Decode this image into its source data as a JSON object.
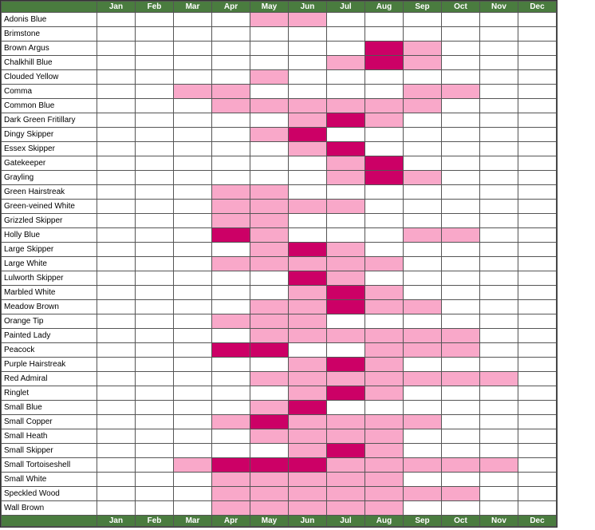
{
  "months": [
    "Jan",
    "Feb",
    "Mar",
    "Apr",
    "May",
    "Jun",
    "Jul",
    "Aug",
    "Sep",
    "Oct",
    "Nov",
    "Dec"
  ],
  "species": [
    {
      "name": "Adonis Blue",
      "cells": [
        "e",
        "e",
        "e",
        "e",
        "pk",
        "pk",
        "e",
        "e",
        "e",
        "e",
        "e",
        "e"
      ]
    },
    {
      "name": "Brimstone",
      "cells": [
        "e",
        "e",
        "e",
        "e",
        "e",
        "e",
        "e",
        "e",
        "e",
        "e",
        "e",
        "e"
      ]
    },
    {
      "name": "Brown Argus",
      "cells": [
        "e",
        "e",
        "e",
        "e",
        "e",
        "e",
        "e",
        "dp",
        "pk",
        "e",
        "e",
        "e"
      ]
    },
    {
      "name": "Chalkhill Blue",
      "cells": [
        "e",
        "e",
        "e",
        "e",
        "e",
        "e",
        "pk",
        "dp",
        "pk",
        "e",
        "e",
        "e"
      ]
    },
    {
      "name": "Clouded Yellow",
      "cells": [
        "e",
        "e",
        "e",
        "e",
        "pk",
        "e",
        "e",
        "e",
        "e",
        "e",
        "e",
        "e"
      ]
    },
    {
      "name": "Comma",
      "cells": [
        "e",
        "e",
        "pk",
        "pk",
        "e",
        "e",
        "e",
        "e",
        "pk",
        "pk",
        "e",
        "e"
      ]
    },
    {
      "name": "Common Blue",
      "cells": [
        "e",
        "e",
        "e",
        "pk",
        "pk",
        "pk",
        "pk",
        "pk",
        "pk",
        "e",
        "e",
        "e"
      ]
    },
    {
      "name": "Dark Green Fritillary",
      "cells": [
        "e",
        "e",
        "e",
        "e",
        "e",
        "pk",
        "dp",
        "pk",
        "e",
        "e",
        "e",
        "e"
      ]
    },
    {
      "name": "Dingy Skipper",
      "cells": [
        "e",
        "e",
        "e",
        "e",
        "pk",
        "dp",
        "e",
        "e",
        "e",
        "e",
        "e",
        "e"
      ]
    },
    {
      "name": "Essex Skipper",
      "cells": [
        "e",
        "e",
        "e",
        "e",
        "e",
        "pk",
        "dp",
        "e",
        "e",
        "e",
        "e",
        "e"
      ]
    },
    {
      "name": "Gatekeeper",
      "cells": [
        "e",
        "e",
        "e",
        "e",
        "e",
        "e",
        "pk",
        "dp",
        "e",
        "e",
        "e",
        "e"
      ]
    },
    {
      "name": "Grayling",
      "cells": [
        "e",
        "e",
        "e",
        "e",
        "e",
        "e",
        "pk",
        "dp",
        "pk",
        "e",
        "e",
        "e"
      ]
    },
    {
      "name": "Green Hairstreak",
      "cells": [
        "e",
        "e",
        "e",
        "pk",
        "pk",
        "e",
        "e",
        "e",
        "e",
        "e",
        "e",
        "e"
      ]
    },
    {
      "name": "Green-veined White",
      "cells": [
        "e",
        "e",
        "e",
        "pk",
        "pk",
        "pk",
        "pk",
        "e",
        "e",
        "e",
        "e",
        "e"
      ]
    },
    {
      "name": "Grizzled Skipper",
      "cells": [
        "e",
        "e",
        "e",
        "pk",
        "pk",
        "e",
        "e",
        "e",
        "e",
        "e",
        "e",
        "e"
      ]
    },
    {
      "name": "Holly Blue",
      "cells": [
        "e",
        "e",
        "e",
        "dp",
        "pk",
        "e",
        "e",
        "e",
        "pk",
        "pk",
        "e",
        "e"
      ]
    },
    {
      "name": "Large Skipper",
      "cells": [
        "e",
        "e",
        "e",
        "e",
        "pk",
        "dp",
        "pk",
        "e",
        "e",
        "e",
        "e",
        "e"
      ]
    },
    {
      "name": "Large White",
      "cells": [
        "e",
        "e",
        "e",
        "pk",
        "pk",
        "pk",
        "pk",
        "pk",
        "e",
        "e",
        "e",
        "e"
      ]
    },
    {
      "name": "Lulworth Skipper",
      "cells": [
        "e",
        "e",
        "e",
        "e",
        "e",
        "dp",
        "pk",
        "e",
        "e",
        "e",
        "e",
        "e"
      ]
    },
    {
      "name": "Marbled White",
      "cells": [
        "e",
        "e",
        "e",
        "e",
        "e",
        "pk",
        "dp",
        "pk",
        "e",
        "e",
        "e",
        "e"
      ]
    },
    {
      "name": "Meadow Brown",
      "cells": [
        "e",
        "e",
        "e",
        "e",
        "pk",
        "pk",
        "dp",
        "pk",
        "pk",
        "e",
        "e",
        "e"
      ]
    },
    {
      "name": "Orange Tip",
      "cells": [
        "e",
        "e",
        "e",
        "pk",
        "pk",
        "pk",
        "e",
        "e",
        "e",
        "e",
        "e",
        "e"
      ]
    },
    {
      "name": "Painted Lady",
      "cells": [
        "e",
        "e",
        "e",
        "e",
        "pk",
        "pk",
        "pk",
        "pk",
        "pk",
        "pk",
        "e",
        "e"
      ]
    },
    {
      "name": "Peacock",
      "cells": [
        "e",
        "e",
        "e",
        "dp",
        "dp",
        "e",
        "e",
        "pk",
        "pk",
        "pk",
        "e",
        "e"
      ]
    },
    {
      "name": "Purple Hairstreak",
      "cells": [
        "e",
        "e",
        "e",
        "e",
        "e",
        "pk",
        "dp",
        "pk",
        "e",
        "e",
        "e",
        "e"
      ]
    },
    {
      "name": "Red Admiral",
      "cells": [
        "e",
        "e",
        "e",
        "e",
        "pk",
        "pk",
        "pk",
        "pk",
        "pk",
        "pk",
        "pk",
        "e"
      ]
    },
    {
      "name": "Ringlet",
      "cells": [
        "e",
        "e",
        "e",
        "e",
        "e",
        "pk",
        "dp",
        "pk",
        "e",
        "e",
        "e",
        "e"
      ]
    },
    {
      "name": "Small Blue",
      "cells": [
        "e",
        "e",
        "e",
        "e",
        "pk",
        "dp",
        "e",
        "e",
        "e",
        "e",
        "e",
        "e"
      ]
    },
    {
      "name": "Small Copper",
      "cells": [
        "e",
        "e",
        "e",
        "pk",
        "dp",
        "pk",
        "pk",
        "pk",
        "pk",
        "e",
        "e",
        "e"
      ]
    },
    {
      "name": "Small Heath",
      "cells": [
        "e",
        "e",
        "e",
        "e",
        "pk",
        "pk",
        "pk",
        "pk",
        "e",
        "e",
        "e",
        "e"
      ]
    },
    {
      "name": "Small Skipper",
      "cells": [
        "e",
        "e",
        "e",
        "e",
        "e",
        "pk",
        "dp",
        "pk",
        "e",
        "e",
        "e",
        "e"
      ]
    },
    {
      "name": "Small Tortoiseshell",
      "cells": [
        "e",
        "e",
        "pk",
        "dp",
        "dp",
        "dp",
        "pk",
        "pk",
        "pk",
        "pk",
        "pk",
        "e"
      ]
    },
    {
      "name": "Small White",
      "cells": [
        "e",
        "e",
        "e",
        "pk",
        "pk",
        "pk",
        "pk",
        "pk",
        "e",
        "e",
        "e",
        "e"
      ]
    },
    {
      "name": "Speckled Wood",
      "cells": [
        "e",
        "e",
        "e",
        "pk",
        "pk",
        "pk",
        "pk",
        "pk",
        "pk",
        "pk",
        "e",
        "e"
      ]
    },
    {
      "name": "Wall Brown",
      "cells": [
        "e",
        "e",
        "e",
        "pk",
        "pk",
        "pk",
        "pk",
        "pk",
        "e",
        "e",
        "e",
        "e"
      ]
    }
  ],
  "colors": {
    "header_bg": "#4a7c3f",
    "header_text": "#ffffff",
    "pink": "#f9a8c9",
    "dark_pink": "#cc0066",
    "empty": "#ffffff"
  }
}
